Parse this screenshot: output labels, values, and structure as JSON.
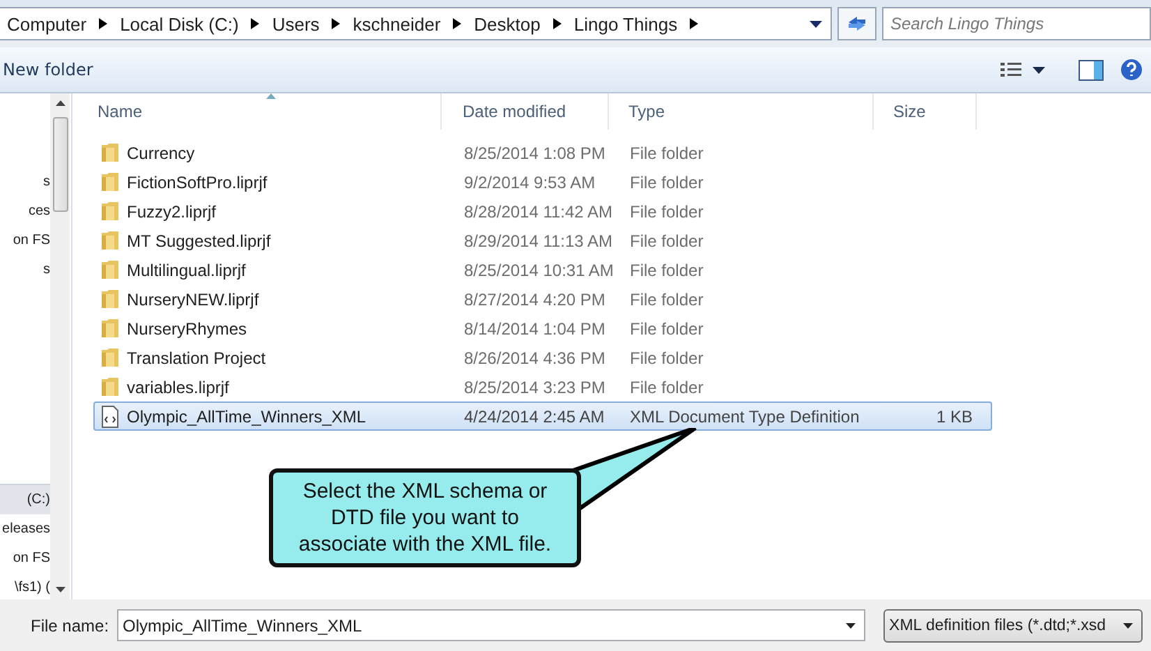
{
  "address_bar": {
    "crumbs": [
      "Computer",
      "Local Disk (C:)",
      "Users",
      "kschneider",
      "Desktop",
      "Lingo Things"
    ],
    "search": {
      "placeholder": "Search Lingo Things"
    }
  },
  "toolbar": {
    "new_folder": "New folder"
  },
  "nav_pane": {
    "items": [
      {
        "label": "s",
        "selected": false
      },
      {
        "label": "ces",
        "selected": false
      },
      {
        "label": "on FS",
        "selected": false
      },
      {
        "label": "s",
        "selected": false
      },
      {
        "label": "(C:)",
        "selected": true
      },
      {
        "label": "eleases",
        "selected": false
      },
      {
        "label": "on FS",
        "selected": false
      },
      {
        "label": "\\fs1) (",
        "selected": false
      }
    ]
  },
  "table": {
    "columns": [
      "Name",
      "Date modified",
      "Type",
      "Size"
    ],
    "rows": [
      {
        "kind": "folder",
        "name": "Currency",
        "date": "8/25/2014 1:08 PM",
        "type": "File folder",
        "size": "",
        "selected": false
      },
      {
        "kind": "folder",
        "name": "FictionSoftPro.liprjf",
        "date": "9/2/2014 9:53 AM",
        "type": "File folder",
        "size": "",
        "selected": false
      },
      {
        "kind": "folder",
        "name": "Fuzzy2.liprjf",
        "date": "8/28/2014 11:42 AM",
        "type": "File folder",
        "size": "",
        "selected": false
      },
      {
        "kind": "folder",
        "name": "MT Suggested.liprjf",
        "date": "8/29/2014 11:13 AM",
        "type": "File folder",
        "size": "",
        "selected": false
      },
      {
        "kind": "folder",
        "name": "Multilingual.liprjf",
        "date": "8/25/2014 10:31 AM",
        "type": "File folder",
        "size": "",
        "selected": false
      },
      {
        "kind": "folder",
        "name": "NurseryNEW.liprjf",
        "date": "8/27/2014 4:20 PM",
        "type": "File folder",
        "size": "",
        "selected": false
      },
      {
        "kind": "folder",
        "name": "NurseryRhymes",
        "date": "8/14/2014 1:04 PM",
        "type": "File folder",
        "size": "",
        "selected": false
      },
      {
        "kind": "folder",
        "name": "Translation Project",
        "date": "8/26/2014 4:36 PM",
        "type": "File folder",
        "size": "",
        "selected": false
      },
      {
        "kind": "folder",
        "name": "variables.liprjf",
        "date": "8/25/2014 3:23 PM",
        "type": "File folder",
        "size": "",
        "selected": false
      },
      {
        "kind": "file",
        "name": "Olympic_AllTime_Winners_XML",
        "date": "4/24/2014 2:45 AM",
        "type": "XML Document Type Definition",
        "size": "1 KB",
        "selected": true
      }
    ]
  },
  "callout": {
    "text": "Select the XML schema or DTD file you want to associate with the XML file."
  },
  "footer": {
    "file_name_label": "File name:",
    "file_name_value": "Olympic_AllTime_Winners_XML",
    "filter": "XML definition files (*.dtd;*.xsd"
  }
}
